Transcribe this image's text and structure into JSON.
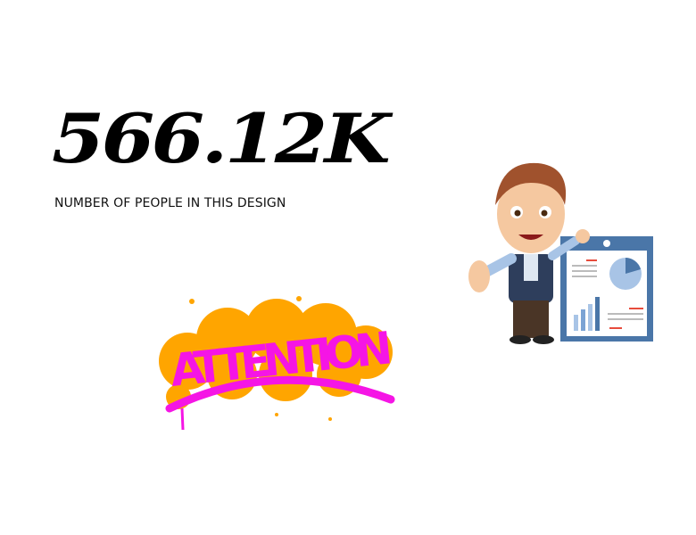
{
  "stat": {
    "value": "566.12K",
    "label": "NUMBER OF PEOPLE IN THIS DESIGN"
  },
  "graphic": {
    "text": "ATTENTION",
    "colors": {
      "splash": "#FFA500",
      "text": "#F515E5"
    }
  },
  "illustration": {
    "icon": "businessman-presenting-chart-icon",
    "colors": {
      "board": "#4A76A8",
      "suit": "#2E3E5C",
      "skin": "#F5C8A0",
      "hair": "#A0522D"
    }
  }
}
